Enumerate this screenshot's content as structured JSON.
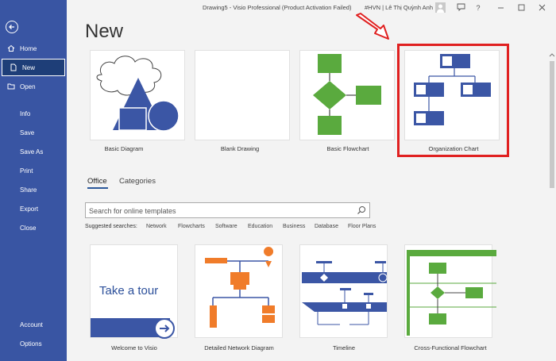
{
  "window": {
    "title": "Drawing5 - Visio Professional (Product Activation Failed)",
    "user": "#HVN | Lê Thị Quỳnh Anh",
    "help": "?"
  },
  "sidebar": {
    "items": [
      {
        "label": "Home"
      },
      {
        "label": "New"
      },
      {
        "label": "Open"
      },
      {
        "label": "Info"
      },
      {
        "label": "Save"
      },
      {
        "label": "Save As"
      },
      {
        "label": "Print"
      },
      {
        "label": "Share"
      },
      {
        "label": "Export"
      },
      {
        "label": "Close"
      },
      {
        "label": "Account"
      },
      {
        "label": "Options"
      }
    ]
  },
  "page": {
    "title": "New"
  },
  "featured": [
    {
      "label": "Basic Diagram"
    },
    {
      "label": "Blank Drawing"
    },
    {
      "label": "Basic Flowchart"
    },
    {
      "label": "Organization Chart"
    }
  ],
  "tabs": [
    {
      "label": "Office"
    },
    {
      "label": "Categories"
    }
  ],
  "search": {
    "placeholder": "Search for online templates"
  },
  "suggested": {
    "label": "Suggested searches:",
    "items": [
      "Network",
      "Flowcharts",
      "Software",
      "Education",
      "Business",
      "Database",
      "Floor Plans"
    ]
  },
  "templates": [
    {
      "label": "Welcome to Visio",
      "tour_text": "Take a tour"
    },
    {
      "label": "Detailed Network Diagram"
    },
    {
      "label": "Timeline"
    },
    {
      "label": "Cross-Functional Flowchart"
    }
  ],
  "colors": {
    "sidebar": "#3955a3",
    "accent_blue": "#3b56a5",
    "shape_green": "#5aaa3e",
    "shape_orange": "#f07c2a",
    "highlight_red": "#e02020"
  }
}
